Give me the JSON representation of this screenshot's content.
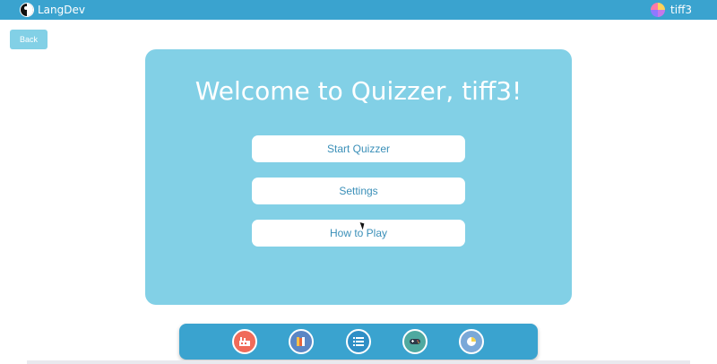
{
  "header": {
    "brand_name": "LangDev",
    "brand_icon": "yin-yang-icon",
    "user_name": "tiff3",
    "user_icon": "user-avatar-icon"
  },
  "nav": {
    "back_label": "Back"
  },
  "main": {
    "welcome_text": "Welcome to Quizzer, tiff3!",
    "buttons": [
      {
        "label": "Start Quizzer"
      },
      {
        "label": "Settings"
      },
      {
        "label": "How to Play"
      }
    ]
  },
  "dock": {
    "items": [
      {
        "icon": "factory-icon",
        "color": "#f06b5a"
      },
      {
        "icon": "books-icon",
        "color": "#5b86c5"
      },
      {
        "icon": "list-icon",
        "color": "#2f8fc6"
      },
      {
        "icon": "gamepad-icon",
        "color": "#4fa9a0"
      },
      {
        "icon": "pie-chart-icon",
        "color": "#7aa8d8"
      }
    ]
  },
  "colors": {
    "topbar": "#3aa3cf",
    "card": "#82d0e6",
    "button_text": "#3a8fb8"
  }
}
